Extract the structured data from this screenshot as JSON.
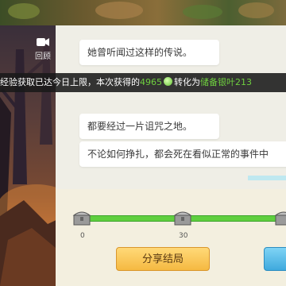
{
  "replay": {
    "label": "回顾"
  },
  "dialog": [
    "她曾听闻过这样的传说。",
    "都要经过一片诅咒之地。",
    "不论如何挣扎，都会死在看似正常的事件中"
  ],
  "notice": {
    "prefix": "经验获取已达今日上限，本次获得的",
    "amount": "4965",
    "middle": "转化为",
    "reward": "储备银叶213"
  },
  "progress": {
    "milestones": [
      "0",
      "30"
    ],
    "fill_fraction": 1.0
  },
  "buttons": {
    "share": "分享结局"
  },
  "colors": {
    "progress": "#5fcf3f",
    "share_button": "#f5b941",
    "highlight_text": "#6fcf3f"
  }
}
